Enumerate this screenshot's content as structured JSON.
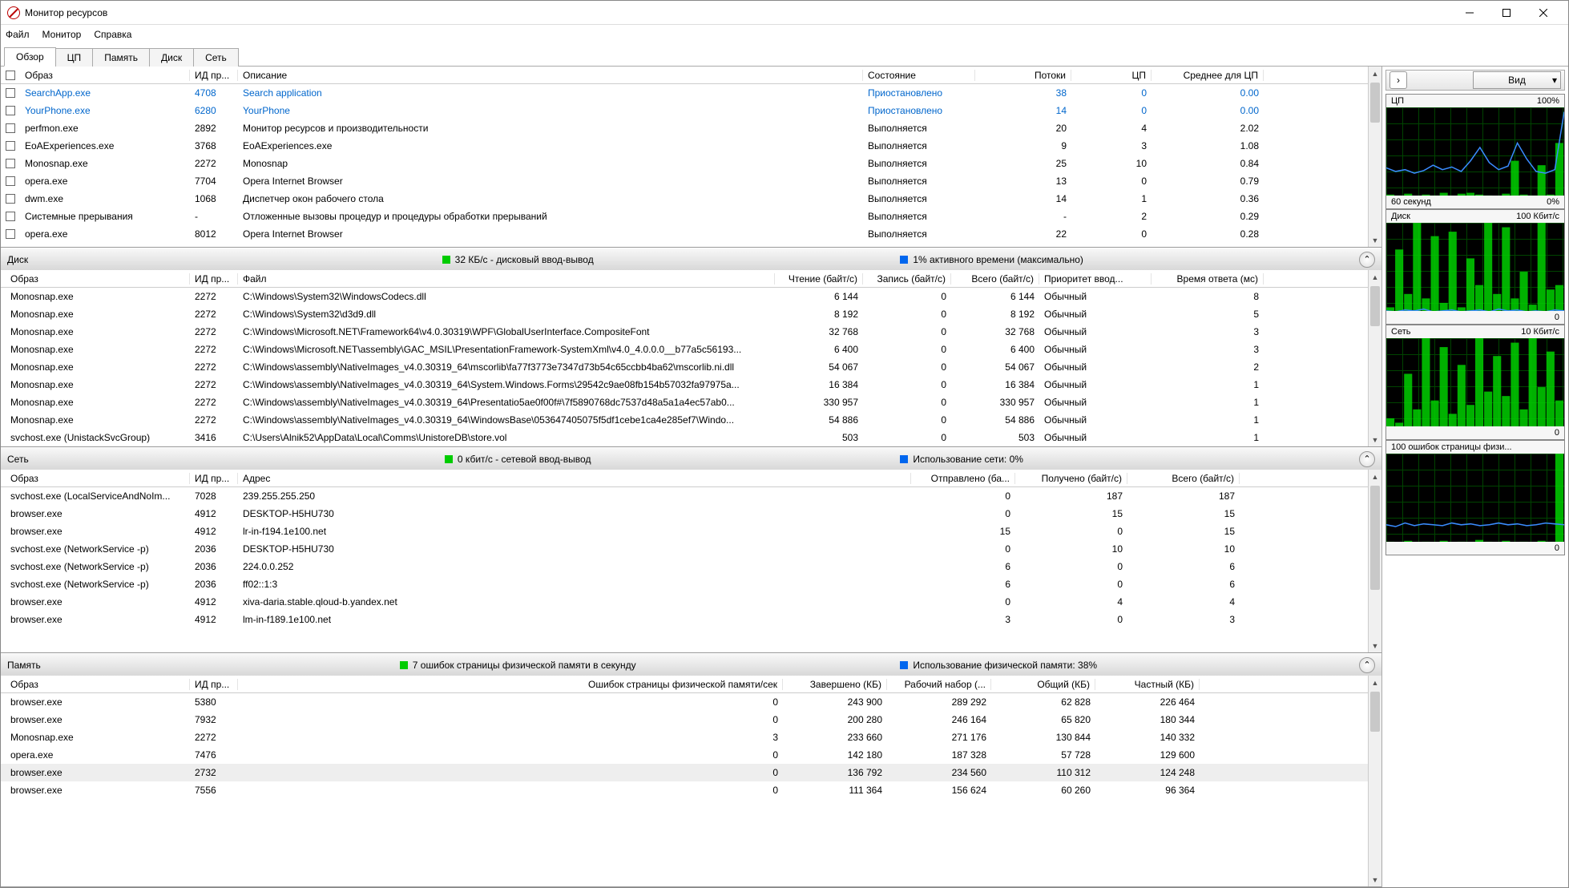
{
  "window": {
    "title": "Монитор ресурсов"
  },
  "menu": {
    "items": [
      "Файл",
      "Монитор",
      "Справка"
    ]
  },
  "tabs": {
    "items": [
      "Обзор",
      "ЦП",
      "Память",
      "Диск",
      "Сеть"
    ],
    "active": 0
  },
  "cpu": {
    "headers": [
      "Образ",
      "ИД пр...",
      "Описание",
      "Состояние",
      "Потоки",
      "ЦП",
      "Среднее для ЦП"
    ],
    "rows": [
      {
        "img": "SearchApp.exe",
        "pid": "4708",
        "desc": "Search application",
        "state": "Приостановлено",
        "threads": "38",
        "cpu": "0",
        "avg": "0.00",
        "suspended": true
      },
      {
        "img": "YourPhone.exe",
        "pid": "6280",
        "desc": "YourPhone",
        "state": "Приостановлено",
        "threads": "14",
        "cpu": "0",
        "avg": "0.00",
        "suspended": true
      },
      {
        "img": "perfmon.exe",
        "pid": "2892",
        "desc": "Монитор ресурсов и производительности",
        "state": "Выполняется",
        "threads": "20",
        "cpu": "4",
        "avg": "2.02"
      },
      {
        "img": "EoAExperiences.exe",
        "pid": "3768",
        "desc": "EoAExperiences.exe",
        "state": "Выполняется",
        "threads": "9",
        "cpu": "3",
        "avg": "1.08"
      },
      {
        "img": "Monosnap.exe",
        "pid": "2272",
        "desc": "Monosnap",
        "state": "Выполняется",
        "threads": "25",
        "cpu": "10",
        "avg": "0.84"
      },
      {
        "img": "opera.exe",
        "pid": "7704",
        "desc": "Opera Internet Browser",
        "state": "Выполняется",
        "threads": "13",
        "cpu": "0",
        "avg": "0.79"
      },
      {
        "img": "dwm.exe",
        "pid": "1068",
        "desc": "Диспетчер окон рабочего стола",
        "state": "Выполняется",
        "threads": "14",
        "cpu": "1",
        "avg": "0.36"
      },
      {
        "img": "Системные прерывания",
        "pid": "-",
        "desc": "Отложенные вызовы процедур и процедуры обработки прерываний",
        "state": "Выполняется",
        "threads": "-",
        "cpu": "2",
        "avg": "0.29"
      },
      {
        "img": "opera.exe",
        "pid": "8012",
        "desc": "Opera Internet Browser",
        "state": "Выполняется",
        "threads": "22",
        "cpu": "0",
        "avg": "0.28"
      }
    ]
  },
  "disk": {
    "title": "Диск",
    "stat1": "32 КБ/c - дисковый ввод-вывод",
    "stat2": "1% активного времени (максимально)",
    "headers": [
      "Образ",
      "ИД пр...",
      "Файл",
      "Чтение (байт/c)",
      "Запись (байт/c)",
      "Всего (байт/c)",
      "Приоритет ввод...",
      "Время ответа (мс)"
    ],
    "rows": [
      {
        "img": "Monosnap.exe",
        "pid": "2272",
        "file": "C:\\Windows\\System32\\WindowsCodecs.dll",
        "r": "6 144",
        "w": "0",
        "t": "6 144",
        "pr": "Обычный",
        "rt": "8"
      },
      {
        "img": "Monosnap.exe",
        "pid": "2272",
        "file": "C:\\Windows\\System32\\d3d9.dll",
        "r": "8 192",
        "w": "0",
        "t": "8 192",
        "pr": "Обычный",
        "rt": "5"
      },
      {
        "img": "Monosnap.exe",
        "pid": "2272",
        "file": "C:\\Windows\\Microsoft.NET\\Framework64\\v4.0.30319\\WPF\\GlobalUserInterface.CompositeFont",
        "r": "32 768",
        "w": "0",
        "t": "32 768",
        "pr": "Обычный",
        "rt": "3"
      },
      {
        "img": "Monosnap.exe",
        "pid": "2272",
        "file": "C:\\Windows\\Microsoft.NET\\assembly\\GAC_MSIL\\PresentationFramework-SystemXml\\v4.0_4.0.0.0__b77a5c56193...",
        "r": "6 400",
        "w": "0",
        "t": "6 400",
        "pr": "Обычный",
        "rt": "3"
      },
      {
        "img": "Monosnap.exe",
        "pid": "2272",
        "file": "C:\\Windows\\assembly\\NativeImages_v4.0.30319_64\\mscorlib\\fa77f3773e7347d73b54c65ccbb4ba62\\mscorlib.ni.dll",
        "r": "54 067",
        "w": "0",
        "t": "54 067",
        "pr": "Обычный",
        "rt": "2"
      },
      {
        "img": "Monosnap.exe",
        "pid": "2272",
        "file": "C:\\Windows\\assembly\\NativeImages_v4.0.30319_64\\System.Windows.Forms\\29542c9ae08fb154b57032fa97975a...",
        "r": "16 384",
        "w": "0",
        "t": "16 384",
        "pr": "Обычный",
        "rt": "1"
      },
      {
        "img": "Monosnap.exe",
        "pid": "2272",
        "file": "C:\\Windows\\assembly\\NativeImages_v4.0.30319_64\\Presentatio5ae0f00f#\\7f5890768dc7537d48a5a1a4ec57ab0...",
        "r": "330 957",
        "w": "0",
        "t": "330 957",
        "pr": "Обычный",
        "rt": "1"
      },
      {
        "img": "Monosnap.exe",
        "pid": "2272",
        "file": "C:\\Windows\\assembly\\NativeImages_v4.0.30319_64\\WindowsBase\\053647405075f5df1cebe1ca4e285ef7\\Windo...",
        "r": "54 886",
        "w": "0",
        "t": "54 886",
        "pr": "Обычный",
        "rt": "1"
      },
      {
        "img": "svchost.exe (UnistackSvcGroup)",
        "pid": "3416",
        "file": "C:\\Users\\Alnik52\\AppData\\Local\\Comms\\UnistoreDB\\store.vol",
        "r": "503",
        "w": "0",
        "t": "503",
        "pr": "Обычный",
        "rt": "1"
      }
    ]
  },
  "net": {
    "title": "Сеть",
    "stat1": "0 кбит/с - сетевой ввод-вывод",
    "stat2": "Использование сети: 0%",
    "headers": [
      "Образ",
      "ИД пр...",
      "Адрес",
      "Отправлено (ба...",
      "Получено (байт/с)",
      "Всего (байт/c)"
    ],
    "rows": [
      {
        "img": "svchost.exe (LocalServiceAndNoIm...",
        "pid": "7028",
        "addr": "239.255.255.250",
        "s": "0",
        "r": "187",
        "t": "187"
      },
      {
        "img": "browser.exe",
        "pid": "4912",
        "addr": "DESKTOP-H5HU730",
        "s": "0",
        "r": "15",
        "t": "15"
      },
      {
        "img": "browser.exe",
        "pid": "4912",
        "addr": "lr-in-f194.1e100.net",
        "s": "15",
        "r": "0",
        "t": "15"
      },
      {
        "img": "svchost.exe (NetworkService -p)",
        "pid": "2036",
        "addr": "DESKTOP-H5HU730",
        "s": "0",
        "r": "10",
        "t": "10"
      },
      {
        "img": "svchost.exe (NetworkService -p)",
        "pid": "2036",
        "addr": "224.0.0.252",
        "s": "6",
        "r": "0",
        "t": "6"
      },
      {
        "img": "svchost.exe (NetworkService -p)",
        "pid": "2036",
        "addr": "ff02::1:3",
        "s": "6",
        "r": "0",
        "t": "6"
      },
      {
        "img": "browser.exe",
        "pid": "4912",
        "addr": "xiva-daria.stable.qloud-b.yandex.net",
        "s": "0",
        "r": "4",
        "t": "4"
      },
      {
        "img": "browser.exe",
        "pid": "4912",
        "addr": "lm-in-f189.1e100.net",
        "s": "3",
        "r": "0",
        "t": "3"
      }
    ]
  },
  "mem": {
    "title": "Память",
    "stat1": "7 ошибок страницы физической памяти в секунду",
    "stat2": "Использование физической памяти: 38%",
    "headers": [
      "Образ",
      "ИД пр...",
      "Ошибок страницы физической памяти/сек",
      "Завершено (КБ)",
      "Рабочий набор (...",
      "Общий (КБ)",
      "Частный (КБ)"
    ],
    "rows": [
      {
        "img": "browser.exe",
        "pid": "5380",
        "f": "0",
        "c": "243 900",
        "w": "289 292",
        "s": "62 828",
        "p": "226 464"
      },
      {
        "img": "browser.exe",
        "pid": "7932",
        "f": "0",
        "c": "200 280",
        "w": "246 164",
        "s": "65 820",
        "p": "180 344"
      },
      {
        "img": "Monosnap.exe",
        "pid": "2272",
        "f": "3",
        "c": "233 660",
        "w": "271 176",
        "s": "130 844",
        "p": "140 332"
      },
      {
        "img": "opera.exe",
        "pid": "7476",
        "f": "0",
        "c": "142 180",
        "w": "187 328",
        "s": "57 728",
        "p": "129 600"
      },
      {
        "img": "browser.exe",
        "pid": "2732",
        "f": "0",
        "c": "136 792",
        "w": "234 560",
        "s": "110 312",
        "p": "124 248",
        "hl": true
      },
      {
        "img": "browser.exe",
        "pid": "7556",
        "f": "0",
        "c": "111 364",
        "w": "156 624",
        "s": "60 260",
        "p": "96 364"
      }
    ]
  },
  "side": {
    "view_label": "Вид",
    "charts": [
      {
        "title": "ЦП",
        "right": "100%",
        "footer_l": "60 секунд",
        "footer_r": "0%",
        "blue": [
          32,
          28,
          30,
          26,
          29,
          35,
          30,
          33,
          28,
          40,
          55,
          38,
          30,
          34,
          60,
          42,
          28,
          26,
          30,
          95
        ],
        "green": [
          2,
          1,
          3,
          0,
          2,
          1,
          4,
          0,
          3,
          4,
          2,
          1,
          0,
          3,
          40,
          2,
          1,
          35,
          2,
          60
        ]
      },
      {
        "title": "Диск",
        "right": "100 Кбит/с",
        "footer_l": "",
        "footer_r": "0",
        "blue": [
          1,
          0,
          2,
          1,
          3,
          0,
          1,
          2,
          0,
          1,
          2,
          0,
          3,
          1,
          2,
          0,
          1,
          0,
          2,
          1
        ],
        "green": [
          5,
          70,
          20,
          100,
          15,
          85,
          10,
          90,
          5,
          60,
          30,
          100,
          20,
          95,
          15,
          45,
          8,
          100,
          25,
          30
        ]
      },
      {
        "title": "Сеть",
        "right": "10 Кбит/с",
        "footer_l": "",
        "footer_r": "0",
        "blue": [
          0,
          0,
          0,
          0,
          0,
          0,
          0,
          0,
          0,
          0,
          0,
          0,
          0,
          0,
          0,
          0,
          0,
          0,
          0,
          0
        ],
        "green": [
          10,
          5,
          60,
          20,
          100,
          30,
          90,
          15,
          70,
          25,
          100,
          40,
          80,
          35,
          95,
          20,
          100,
          45,
          85,
          30
        ]
      },
      {
        "title": "100 ошибок страницы физи...",
        "right": "",
        "footer_l": "",
        "footer_r": "0",
        "blue": [
          20,
          18,
          22,
          19,
          21,
          20,
          19,
          22,
          20,
          21,
          19,
          20,
          22,
          20,
          21,
          19,
          20,
          22,
          21,
          20
        ],
        "green": [
          1,
          0,
          2,
          0,
          1,
          0,
          2,
          0,
          1,
          0,
          3,
          1,
          0,
          2,
          0,
          1,
          0,
          2,
          1,
          100
        ]
      }
    ]
  }
}
